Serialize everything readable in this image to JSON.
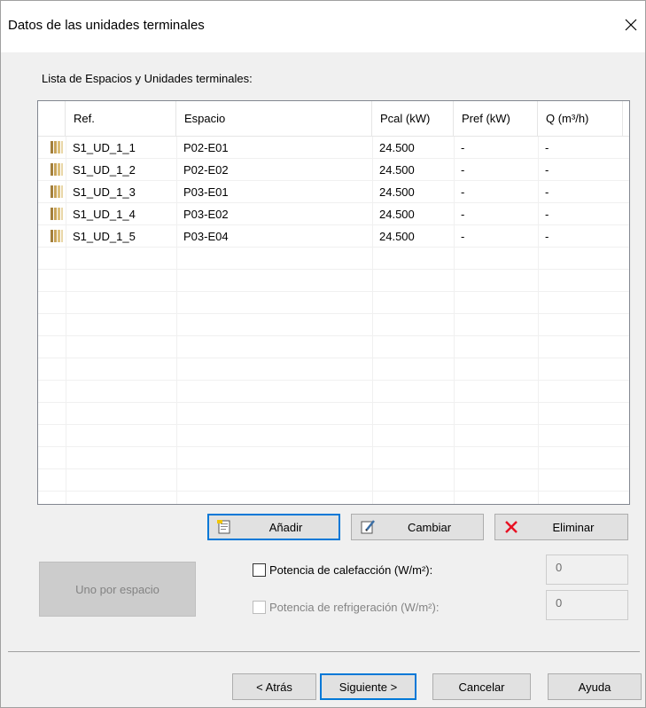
{
  "window": {
    "title": "Datos de las unidades terminales"
  },
  "list": {
    "label": "Lista de Espacios y Unidades terminales:",
    "columns": [
      "Ref.",
      "Espacio",
      "Pcal (kW)",
      "Pref (kW)",
      "Q (m³/h)"
    ],
    "rows": [
      [
        "S1_UD_1_1",
        "P02-E01",
        "24.500",
        "-",
        "-"
      ],
      [
        "S1_UD_1_2",
        "P02-E02",
        "24.500",
        "-",
        "-"
      ],
      [
        "S1_UD_1_3",
        "P03-E01",
        "24.500",
        "-",
        "-"
      ],
      [
        "S1_UD_1_4",
        "P03-E02",
        "24.500",
        "-",
        "-"
      ],
      [
        "S1_UD_1_5",
        "P03-E04",
        "24.500",
        "-",
        "-"
      ]
    ]
  },
  "actions": {
    "add_label": "Añadir",
    "change_label": "Cambiar",
    "delete_label": "Eliminar",
    "per_space_label": "Uno por espacio"
  },
  "options": {
    "heating_label": "Potencia de calefacción (W/m²):",
    "heating_value": "0",
    "cooling_label": "Potencia de refrigeración (W/m²):",
    "cooling_value": "0"
  },
  "footer": {
    "back_label": "< Atrás",
    "next_label": "Siguiente >",
    "cancel_label": "Cancelar",
    "help_label": "Ayuda"
  },
  "colors": {
    "focus": "#0078d7",
    "delete_icon": "#e81123",
    "row_icon": "#c8a45a"
  },
  "icons": [
    "close-icon",
    "terminal-unit-icon",
    "add-document-icon",
    "edit-pencil-icon",
    "delete-x-icon"
  ]
}
